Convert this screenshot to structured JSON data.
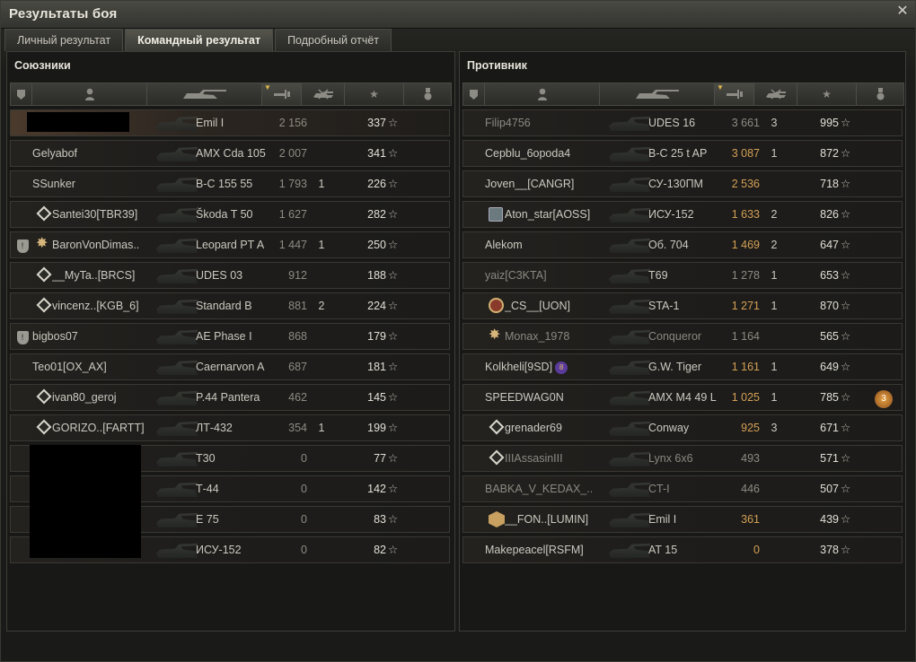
{
  "window": {
    "title": "Результаты боя",
    "close_icon": "close-icon"
  },
  "tabs": [
    {
      "label": "Личный результат",
      "active": false
    },
    {
      "label": "Командный результат",
      "active": true
    },
    {
      "label": "Подробный отчёт",
      "active": false
    }
  ],
  "allies": {
    "title": "Союзники",
    "rows": [
      {
        "name": "",
        "vehicle": "Emil I",
        "damage": "2 156",
        "kills": "",
        "xp": "337",
        "hl": true
      },
      {
        "name": "Gelyabof",
        "vehicle": "AMX Cda 105",
        "damage": "2 007",
        "kills": "",
        "xp": "341"
      },
      {
        "name": "SSunker",
        "vehicle": "В-С 155 55",
        "damage": "1 793",
        "kills": "1",
        "xp": "226"
      },
      {
        "name": "Santei30[TBR39]",
        "vehicle": "Škoda T 50",
        "damage": "1 627",
        "kills": "",
        "xp": "282",
        "rank": "diamond"
      },
      {
        "name": "BaronVonDimas..",
        "vehicle": "Leopard PT A",
        "damage": "1 447",
        "kills": "1",
        "xp": "250",
        "rank": "star",
        "badge": true
      },
      {
        "name": "__MyTa..[BRCS]",
        "vehicle": "UDES 03",
        "damage": "912",
        "kills": "",
        "xp": "188",
        "rank": "diamond"
      },
      {
        "name": "vincenz..[KGB_6]",
        "vehicle": "Standard B",
        "damage": "881",
        "kills": "2",
        "xp": "224",
        "rank": "diamond"
      },
      {
        "name": "bigbos07",
        "vehicle": "AE Phase I",
        "damage": "868",
        "kills": "",
        "xp": "179",
        "badge": true
      },
      {
        "name": "Teo01[OX_AX]",
        "vehicle": "Caernarvon A",
        "damage": "687",
        "kills": "",
        "xp": "181"
      },
      {
        "name": "ivan80_geroj",
        "vehicle": "P.44 Pantera",
        "damage": "462",
        "kills": "",
        "xp": "145",
        "rank": "diamond"
      },
      {
        "name": "GORIZO..[FARTT]",
        "vehicle": "ЛТ-432",
        "damage": "354",
        "kills": "1",
        "xp": "199",
        "rank": "diamond"
      },
      {
        "name": "",
        "vehicle": "T30",
        "damage": "0",
        "kills": "",
        "xp": "77"
      },
      {
        "name": "",
        "vehicle": "Т-44",
        "damage": "0",
        "kills": "",
        "xp": "142"
      },
      {
        "name": "",
        "vehicle": "E 75",
        "damage": "0",
        "kills": "",
        "xp": "83"
      },
      {
        "name": "",
        "vehicle": "ИСУ-152",
        "damage": "0",
        "kills": "",
        "xp": "82"
      }
    ]
  },
  "enemies": {
    "title": "Противник",
    "rows": [
      {
        "name": "Filip4756",
        "vehicle": "UDES 16",
        "damage": "3 661",
        "kills": "3",
        "xp": "995",
        "dim": true
      },
      {
        "name": "Cepblu_6opoda4",
        "vehicle": "В-С 25 t AP",
        "damage": "3 087",
        "kills": "1",
        "xp": "872",
        "orange": true
      },
      {
        "name": "Joven__[CANGR]",
        "vehicle": "СУ-130ПМ",
        "damage": "2 536",
        "kills": "",
        "xp": "718",
        "orange": true
      },
      {
        "name": "Aton_star[AOSS]",
        "vehicle": "ИСУ-152",
        "damage": "1 633",
        "kills": "2",
        "xp": "826",
        "rank": "box",
        "orange": true
      },
      {
        "name": "Alekom",
        "vehicle": "Об. 704",
        "damage": "1 469",
        "kills": "2",
        "xp": "647",
        "orange": true
      },
      {
        "name": "yaiz[C3KTA]",
        "vehicle": "T69",
        "damage": "1 278",
        "kills": "1",
        "xp": "653",
        "dim": true
      },
      {
        "name": "_CS__[UON]",
        "vehicle": "STA-1",
        "damage": "1 271",
        "kills": "1",
        "xp": "870",
        "rank": "circle",
        "orange": true
      },
      {
        "name": "Monax_1978",
        "vehicle": "Conqueror",
        "damage": "1 164",
        "kills": "",
        "xp": "565",
        "rank": "star",
        "dim": true
      },
      {
        "name": "Kolkheli[9SD]",
        "vehicle": "G.W. Tiger",
        "damage": "1 161",
        "kills": "1",
        "xp": "649",
        "clan": "8",
        "orange": true
      },
      {
        "name": "SPEEDWAG0N",
        "vehicle": "AMX M4 49 L",
        "damage": "1 025",
        "kills": "1",
        "xp": "785",
        "medal": "3",
        "orange": true
      },
      {
        "name": "grenader69",
        "vehicle": "Conway",
        "damage": "925",
        "kills": "3",
        "xp": "671",
        "rank": "diamond",
        "orange": true
      },
      {
        "name": "IIIAssasinIII",
        "vehicle": "Lynx 6x6",
        "damage": "493",
        "kills": "",
        "xp": "571",
        "rank": "diamond",
        "dim": true
      },
      {
        "name": "BABKA_V_KEDAX_..",
        "vehicle": "CT-I",
        "damage": "446",
        "kills": "",
        "xp": "507",
        "dim": true
      },
      {
        "name": "__FON..[LUMIN]",
        "vehicle": "Emil I",
        "damage": "361",
        "kills": "",
        "xp": "439",
        "rank": "hex",
        "orange": true
      },
      {
        "name": "Makepeacel[RSFM]",
        "vehicle": "AT 15",
        "damage": "0",
        "kills": "",
        "xp": "378",
        "orange": true
      }
    ]
  },
  "header_icons": [
    "badge-icon",
    "player-icon",
    "vehicle-icon",
    "damage-icon",
    "kills-icon",
    "xp-star-icon",
    "medal-icon"
  ],
  "star_glyph": "☆"
}
